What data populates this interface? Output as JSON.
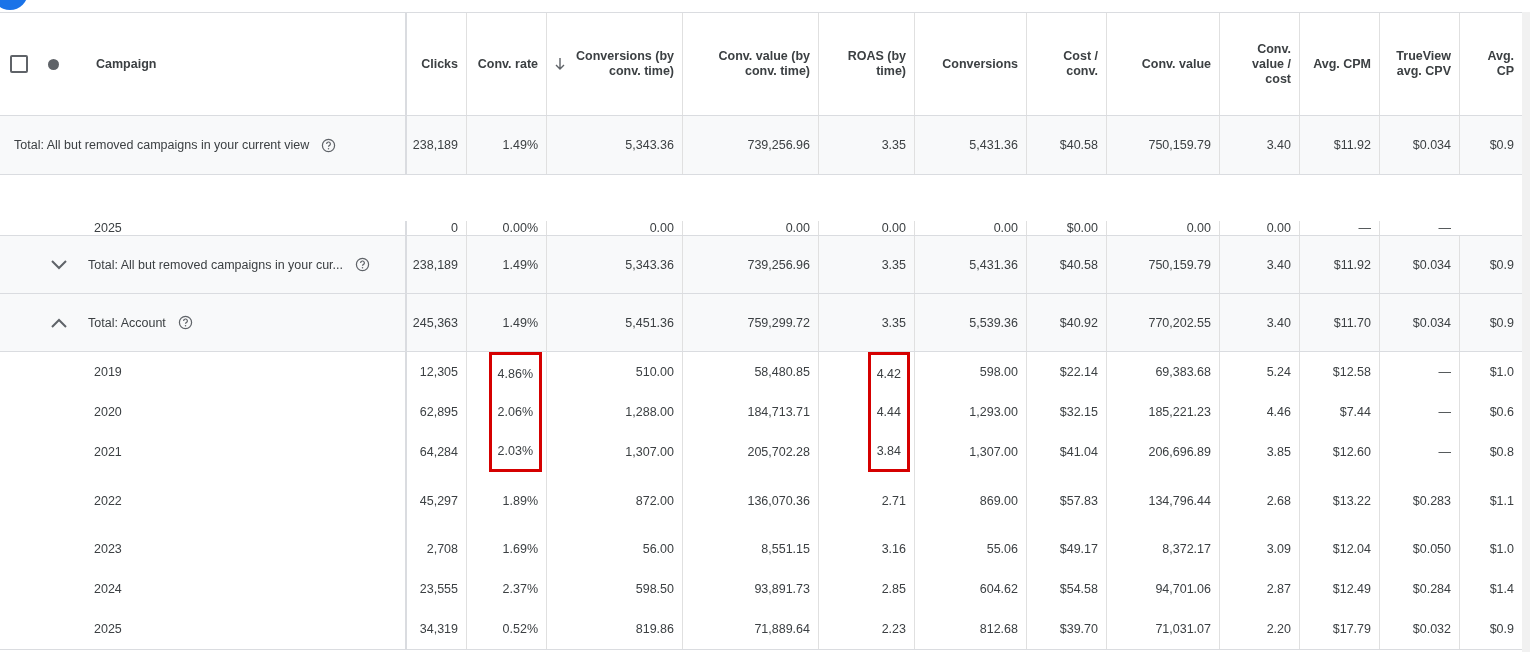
{
  "header": {
    "select_all": {
      "checked": false
    },
    "campaign_label": "Campaign",
    "columns": [
      {
        "label": "Clicks",
        "sorted": false
      },
      {
        "label": "Conv. rate",
        "sorted": false
      },
      {
        "label": "Conversions (by conv. time)",
        "sorted": true
      },
      {
        "label": "Conv. value (by conv. time)",
        "sorted": false
      },
      {
        "label": "ROAS (by time)",
        "sorted": false
      },
      {
        "label": "Conversions",
        "sorted": false
      },
      {
        "label": "Cost / conv.",
        "sorted": false
      },
      {
        "label": "Conv. value",
        "sorted": false
      },
      {
        "label": "Conv. value / cost",
        "sorted": false
      },
      {
        "label": "Avg. CPM",
        "sorted": false
      },
      {
        "label": "TrueView avg. CPV",
        "sorted": false
      },
      {
        "label": "Avg. CP",
        "sorted": false
      }
    ]
  },
  "rows": [
    {
      "kind": "total",
      "label": "Total: All but removed campaigns in your current view",
      "cells": [
        "238,189",
        "1.49%",
        "5,343.36",
        "739,256.96",
        "3.35",
        "5,431.36",
        "$40.58",
        "750,159.79",
        "3.40",
        "$11.92",
        "$0.034",
        "$0.9"
      ]
    },
    {
      "kind": "year",
      "label": "2025",
      "cells": [
        "0",
        "0.00%",
        "0.00",
        "0.00",
        "0.00",
        "0.00",
        "$0.00",
        "0.00",
        "0.00",
        "—",
        "—",
        null
      ]
    },
    {
      "kind": "group",
      "expanded": false,
      "label": "Total: All but removed campaigns in your cur...",
      "cells": [
        "238,189",
        "1.49%",
        "5,343.36",
        "739,256.96",
        "3.35",
        "5,431.36",
        "$40.58",
        "750,159.79",
        "3.40",
        "$11.92",
        "$0.034",
        "$0.9"
      ]
    },
    {
      "kind": "group",
      "expanded": true,
      "label": "Total: Account",
      "cells": [
        "245,363",
        "1.49%",
        "5,451.36",
        "759,299.72",
        "3.35",
        "5,539.36",
        "$40.92",
        "770,202.55",
        "3.40",
        "$11.70",
        "$0.034",
        "$0.9"
      ]
    },
    {
      "kind": "year",
      "label": "2019",
      "cells": [
        "12,305",
        {
          "text": "4.86%",
          "marked": true
        },
        "510.00",
        "58,480.85",
        {
          "text": "4.42",
          "marked": true
        },
        "598.00",
        "$22.14",
        "69,383.68",
        "5.24",
        "$12.58",
        "—",
        "$1.0"
      ]
    },
    {
      "kind": "year",
      "label": "2020",
      "cells": [
        "62,895",
        {
          "text": "2.06%",
          "marked": true
        },
        "1,288.00",
        "184,713.71",
        {
          "text": "4.44",
          "marked": true
        },
        "1,293.00",
        "$32.15",
        "185,221.23",
        "4.46",
        "$7.44",
        "—",
        "$0.6"
      ]
    },
    {
      "kind": "year",
      "label": "2021",
      "cells": [
        "64,284",
        {
          "text": "2.03%",
          "marked": true
        },
        "1,307.00",
        "205,702.28",
        {
          "text": "3.84",
          "marked": true
        },
        "1,307.00",
        "$41.04",
        "206,696.89",
        "3.85",
        "$12.60",
        "—",
        "$0.8"
      ]
    },
    {
      "kind": "year",
      "tall": true,
      "label": "2022",
      "cells": [
        "45,297",
        "1.89%",
        "872.00",
        "136,070.36",
        "2.71",
        "869.00",
        "$57.83",
        "134,796.44",
        "2.68",
        "$13.22",
        "$0.283",
        "$1.1"
      ]
    },
    {
      "kind": "year",
      "label": "2023",
      "cells": [
        "2,708",
        "1.69%",
        "56.00",
        "8,551.15",
        "3.16",
        "55.06",
        "$49.17",
        "8,372.17",
        "3.09",
        "$12.04",
        "$0.050",
        "$1.0"
      ]
    },
    {
      "kind": "year",
      "label": "2024",
      "cells": [
        "23,555",
        "2.37%",
        "598.50",
        "93,891.73",
        "2.85",
        "604.62",
        "$54.58",
        "94,701.06",
        "2.87",
        "$12.49",
        "$0.284",
        "$1.4"
      ]
    },
    {
      "kind": "year",
      "label": "2025",
      "cells": [
        "34,319",
        "0.52%",
        "819.86",
        "71,889.64",
        "2.23",
        "812.68",
        "$39.70",
        "71,031.07",
        "2.20",
        "$17.79",
        "$0.032",
        "$0.9"
      ]
    }
  ]
}
